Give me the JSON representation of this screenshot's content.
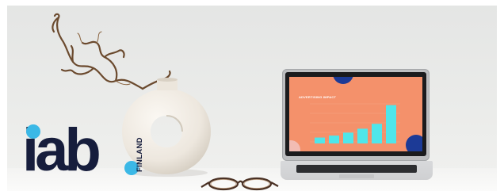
{
  "logo": {
    "text": "iab",
    "subtext": "FINLAND",
    "colors": {
      "text": "#161d3c",
      "accent": "#3bb8e6"
    }
  },
  "laptop_screen": {
    "title": "ADVERTISING IMPACT",
    "background": "#f4916b",
    "bar_color": "#4fe6ea",
    "bar_levels": [
      0.12,
      0.16,
      0.22,
      0.3,
      0.4,
      0.78
    ]
  },
  "objects": [
    "branch",
    "vase",
    "laptop",
    "glasses"
  ]
}
